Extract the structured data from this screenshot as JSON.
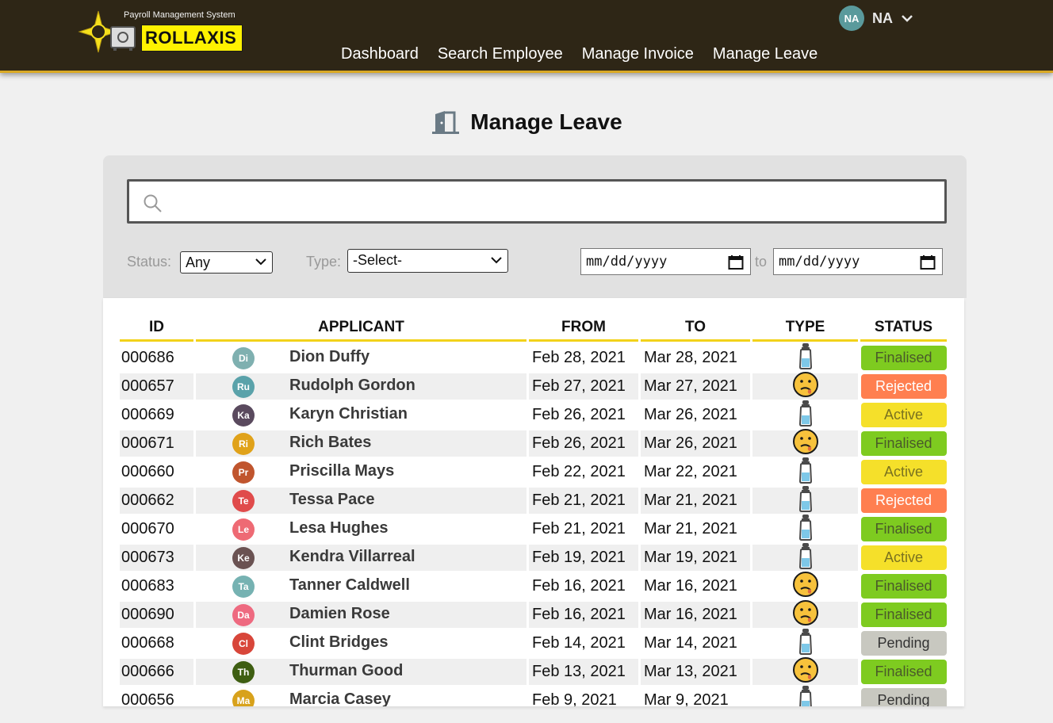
{
  "header": {
    "logo_subtitle": "Payroll Management System",
    "logo_word_a": "ROLL",
    "logo_word_b": "AXIS",
    "user_initials": "NA",
    "user_name": "NA",
    "nav": [
      "Dashboard",
      "Search Employee",
      "Manage Invoice",
      "Manage Leave"
    ]
  },
  "page": {
    "title": "Manage Leave"
  },
  "filters": {
    "search_value": "",
    "status_label": "Status:",
    "status_value": "Any",
    "type_label": "Type:",
    "type_value": "-Select-",
    "date_from_placeholder": "mm/dd/yyyy",
    "to_label": "to",
    "date_to_placeholder": "mm/dd/yyyy"
  },
  "table": {
    "headers": [
      "ID",
      "APPLICANT",
      "FROM",
      "TO",
      "TYPE",
      "STATUS"
    ],
    "rows": [
      {
        "id": "000686",
        "initials": "Di",
        "avatar_color": "#7fb0b0",
        "name": "Dion Duffy",
        "from": "Feb 28, 2021",
        "to": "Mar 28, 2021",
        "type": "bottle-icon",
        "status": "Finalised"
      },
      {
        "id": "000657",
        "initials": "Ru",
        "avatar_color": "#5aa2aa",
        "name": "Rudolph Gordon",
        "from": "Feb 27, 2021",
        "to": "Mar 27, 2021",
        "type": "sick-face-icon",
        "status": "Rejected"
      },
      {
        "id": "000669",
        "initials": "Ka",
        "avatar_color": "#5a4a5e",
        "name": "Karyn Christian",
        "from": "Feb 26, 2021",
        "to": "Mar 26, 2021",
        "type": "bottle-icon",
        "status": "Active"
      },
      {
        "id": "000671",
        "initials": "Ri",
        "avatar_color": "#e0a21a",
        "name": "Rich Bates",
        "from": "Feb 26, 2021",
        "to": "Mar 26, 2021",
        "type": "sick-face-icon",
        "status": "Finalised"
      },
      {
        "id": "000660",
        "initials": "Pr",
        "avatar_color": "#c0552e",
        "name": "Priscilla Mays",
        "from": "Feb 22, 2021",
        "to": "Mar 22, 2021",
        "type": "bottle-icon",
        "status": "Active"
      },
      {
        "id": "000662",
        "initials": "Te",
        "avatar_color": "#e04b4b",
        "name": "Tessa Pace",
        "from": "Feb 21, 2021",
        "to": "Mar 21, 2021",
        "type": "bottle-icon",
        "status": "Rejected"
      },
      {
        "id": "000670",
        "initials": "Le",
        "avatar_color": "#ee6a74",
        "name": "Lesa Hughes",
        "from": "Feb 21, 2021",
        "to": "Mar 21, 2021",
        "type": "bottle-icon",
        "status": "Finalised"
      },
      {
        "id": "000673",
        "initials": "Ke",
        "avatar_color": "#6a5252",
        "name": "Kendra Villarreal",
        "from": "Feb 19, 2021",
        "to": "Mar 19, 2021",
        "type": "bottle-icon",
        "status": "Active"
      },
      {
        "id": "000683",
        "initials": "Ta",
        "avatar_color": "#76b2b2",
        "name": "Tanner Caldwell",
        "from": "Feb 16, 2021",
        "to": "Mar 16, 2021",
        "type": "sick-face-icon",
        "status": "Finalised"
      },
      {
        "id": "000690",
        "initials": "Da",
        "avatar_color": "#ee6a80",
        "name": "Damien Rose",
        "from": "Feb 16, 2021",
        "to": "Mar 16, 2021",
        "type": "sick-face-icon",
        "status": "Finalised"
      },
      {
        "id": "000668",
        "initials": "Cl",
        "avatar_color": "#d8463a",
        "name": "Clint Bridges",
        "from": "Feb 14, 2021",
        "to": "Mar 14, 2021",
        "type": "bottle-icon",
        "status": "Pending"
      },
      {
        "id": "000666",
        "initials": "Th",
        "avatar_color": "#3e5e12",
        "name": "Thurman Good",
        "from": "Feb 13, 2021",
        "to": "Mar 13, 2021",
        "type": "sick-face-icon",
        "status": "Finalised"
      },
      {
        "id": "000656",
        "initials": "Ma",
        "avatar_color": "#d8a21c",
        "name": "Marcia Casey",
        "from": "Feb 9, 2021",
        "to": "Mar 9, 2021",
        "type": "bottle-icon",
        "status": "Pending"
      }
    ]
  },
  "status_colors": {
    "Finalised": {
      "bg": "#7ecb20",
      "fg": "#4a5a2a"
    },
    "Rejected": {
      "bg": "#ff7f50",
      "fg": "#ffffff"
    },
    "Active": {
      "bg": "#f5e02a",
      "fg": "#7a7220"
    },
    "Pending": {
      "bg": "#c8c8c0",
      "fg": "#333333"
    }
  },
  "colors": {
    "header_bg": "#2e2616",
    "accent": "#f2d21a",
    "logo_yellow": "#fff200"
  }
}
